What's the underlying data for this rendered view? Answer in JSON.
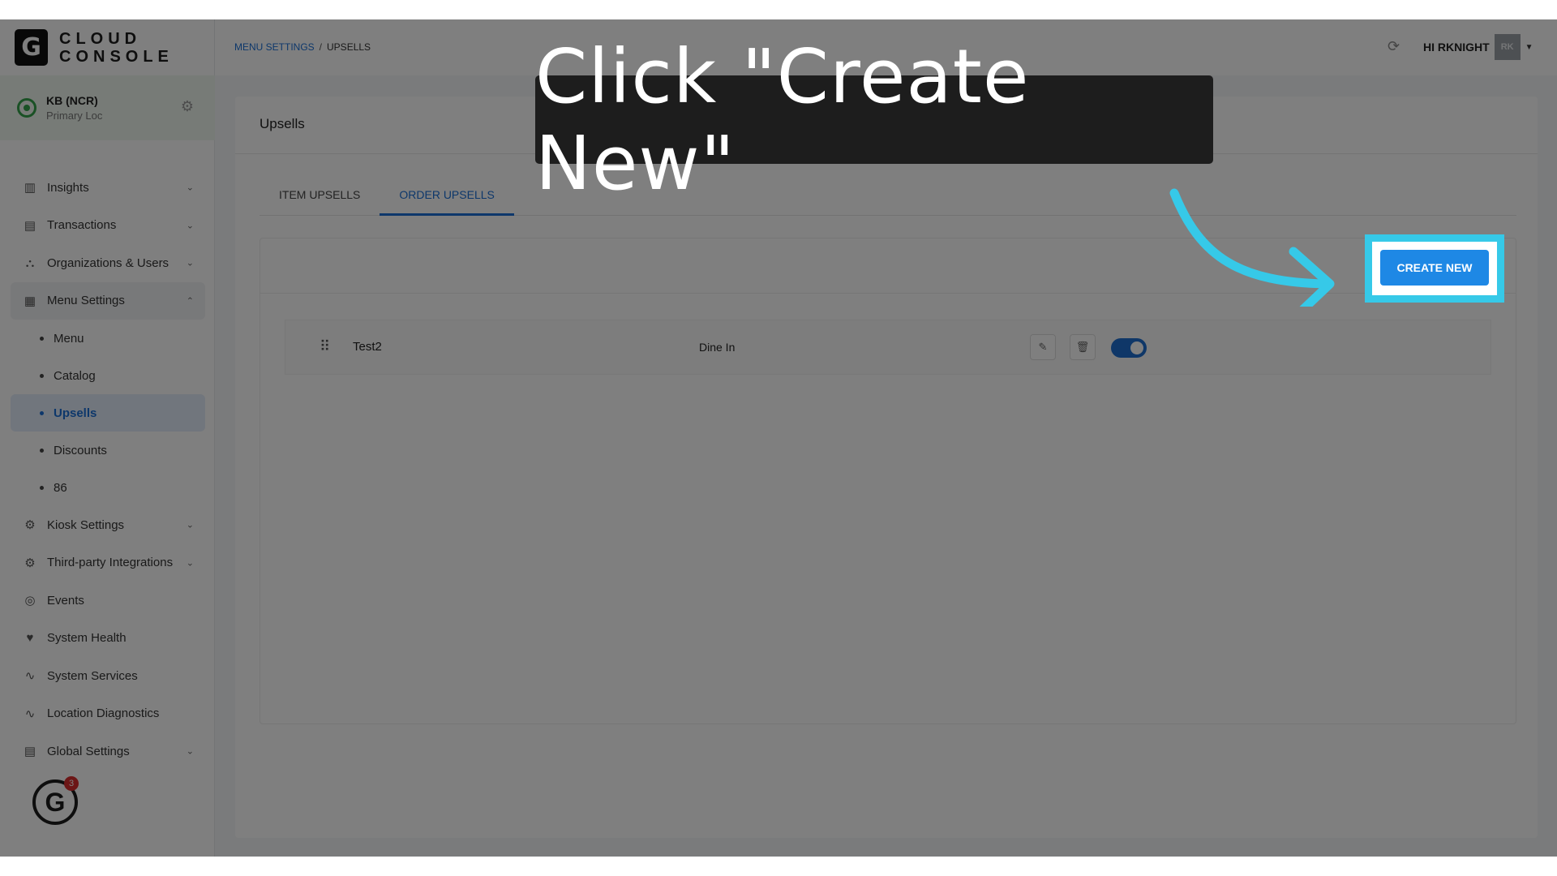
{
  "logo": {
    "mark": "G",
    "line1": "CLOUD",
    "line2": "CONSOLE"
  },
  "location": {
    "name": "KB (NCR)",
    "subtitle": "Primary Loc"
  },
  "sidebar": {
    "items": [
      {
        "label": "Insights",
        "icon": "chart-icon"
      },
      {
        "label": "Transactions",
        "icon": "receipt-icon"
      },
      {
        "label": "Organizations & Users",
        "icon": "org-icon"
      },
      {
        "label": "Menu Settings",
        "icon": "menu-settings-icon",
        "children": [
          "Menu",
          "Catalog",
          "Upsells",
          "Discounts",
          "86"
        ]
      },
      {
        "label": "Kiosk Settings",
        "icon": "gear-icon"
      },
      {
        "label": "Third-party Integrations",
        "icon": "integration-icon"
      },
      {
        "label": "Events",
        "icon": "events-icon"
      },
      {
        "label": "System Health",
        "icon": "heart-icon"
      },
      {
        "label": "System Services",
        "icon": "pulse-icon"
      },
      {
        "label": "Location Diagnostics",
        "icon": "pulse-icon"
      },
      {
        "label": "Global Settings",
        "icon": "document-icon"
      }
    ],
    "help_badge": {
      "mark": "G",
      "count": "3"
    }
  },
  "header": {
    "breadcrumb": [
      "MENU SETTINGS",
      "UPSELLS"
    ],
    "greeting": "HI RKNIGHT",
    "avatar": "RK"
  },
  "page": {
    "title": "Upsells",
    "tabs": [
      "ITEM UPSELLS",
      "ORDER UPSELLS"
    ],
    "active_tab": "ORDER UPSELLS",
    "create_button": "CREATE NEW",
    "rows": [
      {
        "name": "Test2",
        "type": "Dine In",
        "enabled": true
      }
    ]
  },
  "callout": "Click \"Create New\"",
  "colors": {
    "accent": "#1a6fd6",
    "highlight": "#36c9e8",
    "callout_bg": "#1d1d1d"
  }
}
